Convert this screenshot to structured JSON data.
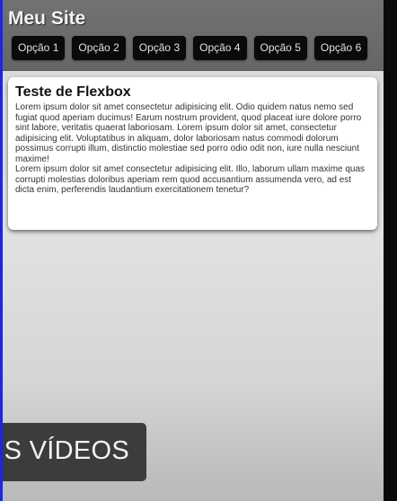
{
  "header": {
    "site_title": "Meu Site",
    "nav_items": [
      "Opção 1",
      "Opção 2",
      "Opção 3",
      "Opção 4",
      "Opção 5",
      "Opção 6"
    ]
  },
  "content": {
    "title": "Teste de Flexbox",
    "paragraphs": [
      "Lorem ipsum dolor sit amet consectetur adipisicing elit. Odio quidem natus nemo sed fugiat quod aperiam ducimus! Earum nostrum provident, quod placeat iure dolore porro sint labore, veritatis quaerat laboriosam. Lorem ipsum dolor sit amet, consectetur adipisicing elit. Voluptatibus in aliquam, dolor laboriosam natus commodi dolorum possimus corrupti illum, distinctio molestiae sed porro odio odit non, iure nulla nesciunt maxime!",
      "Lorem ipsum dolor sit amet consectetur adipisicing elit. Illo, laborum ullam maxime quas corrupti molestias doloribus aperiam rem quod accusantium assumenda vero, ad est dicta enim, perferendis laudantium exercitationem tenetur?"
    ]
  },
  "video_overlay": {
    "label": "AIS VÍDEOS"
  },
  "colors": {
    "left_edge": "#1d2cc2",
    "header_bg": "#6a6a6a",
    "nav_button_bg": "#0a0a0a",
    "card_bg": "#ffffff"
  }
}
